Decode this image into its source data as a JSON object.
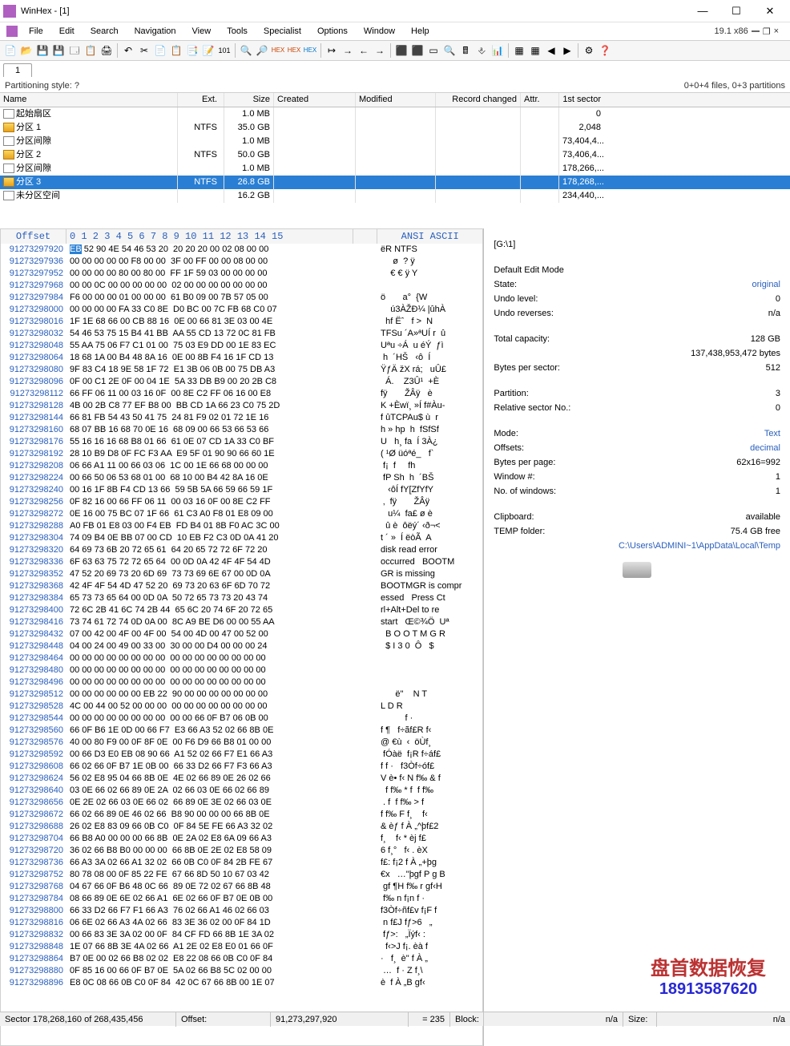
{
  "title": "WinHex - [1]",
  "menus": [
    "File",
    "Edit",
    "Search",
    "Navigation",
    "View",
    "Tools",
    "Specialist",
    "Options",
    "Window",
    "Help"
  ],
  "version": "19.1 x86",
  "tab": "1",
  "summary_left": "Partitioning style: ?",
  "summary_right": "0+0+4 files, 0+3 partitions",
  "cols": {
    "name": "Name",
    "ext": "Ext.",
    "size": "Size",
    "created": "Created",
    "modified": "Modified",
    "rec": "Record changed",
    "attr": "Attr.",
    "sector": "1st sector"
  },
  "rows": [
    {
      "name": "起始扇区",
      "ext": "",
      "size": "1.0 MB",
      "sector": "0",
      "ic": "ic-file"
    },
    {
      "name": "分区 1",
      "ext": "NTFS",
      "size": "35.0 GB",
      "sector": "2,048",
      "ic": "ic-part"
    },
    {
      "name": "分区间隙",
      "ext": "",
      "size": "1.0 MB",
      "sector": "73,404,4...",
      "ic": "ic-gap"
    },
    {
      "name": "分区 2",
      "ext": "NTFS",
      "size": "50.0 GB",
      "sector": "73,406,4...",
      "ic": "ic-part"
    },
    {
      "name": "分区间隙",
      "ext": "",
      "size": "1.0 MB",
      "sector": "178,266,...",
      "ic": "ic-gap"
    },
    {
      "name": "分区 3",
      "ext": "NTFS",
      "size": "26.8 GB",
      "sector": "178,268,...",
      "ic": "ic-part",
      "sel": true
    },
    {
      "name": "未分区空间",
      "ext": "",
      "size": "16.2 GB",
      "sector": "234,440,...",
      "ic": "ic-gap"
    }
  ],
  "hex_headers": {
    "offset": "Offset",
    "bytes": " 0  1  2  3  4  5  6  7   8  9 10 11 12 13 14 15",
    "ascii": "ANSI ASCII"
  },
  "hex": [
    {
      "o": "91273297920",
      "b": "EB 52 90 4E 54 46 53 20  20 20 20 00 02 08 00 00",
      "a": "ëR NTFS         ",
      "hl": true
    },
    {
      "o": "91273297936",
      "b": "00 00 00 00 00 F8 00 00  3F 00 FF 00 00 08 00 00",
      "a": "     ø  ? ÿ     "
    },
    {
      "o": "91273297952",
      "b": "00 00 00 00 80 00 80 00  FF 1F 59 03 00 00 00 00",
      "a": "    € € ÿ Y     "
    },
    {
      "o": "91273297968",
      "b": "00 00 0C 00 00 00 00 00  02 00 00 00 00 00 00 00",
      "a": "                "
    },
    {
      "o": "91273297984",
      "b": "F6 00 00 00 01 00 00 00  61 B0 09 00 7B 57 05 00",
      "a": "ö       a°  {W  "
    },
    {
      "o": "91273298000",
      "b": "00 00 00 00 FA 33 C0 8E  D0 BC 00 7C FB 68 C0 07",
      "a": "    ú3ÀŽÐ¼ |ûhÀ "
    },
    {
      "o": "91273298016",
      "b": "1F 1E 68 66 00 CB 88 16  0E 00 66 81 3E 03 00 4E",
      "a": "  hf Ëˆ   f >  N"
    },
    {
      "o": "91273298032",
      "b": "54 46 53 75 15 B4 41 BB  AA 55 CD 13 72 0C 81 FB",
      "a": "TFSu ´A»ªUÍ r  û"
    },
    {
      "o": "91273298048",
      "b": "55 AA 75 06 F7 C1 01 00  75 03 E9 DD 00 1E 83 EC",
      "a": "Uªu ÷Á  u éÝ  ƒì"
    },
    {
      "o": "91273298064",
      "b": "18 68 1A 00 B4 48 8A 16  0E 00 8B F4 16 1F CD 13",
      "a": " h  ´HŠ   ‹ô  Í "
    },
    {
      "o": "91273298080",
      "b": "9F 83 C4 18 9E 58 1F 72  E1 3B 06 0B 00 75 DB A3",
      "a": "ŸƒÄ žX rá;   uÛ£"
    },
    {
      "o": "91273298096",
      "b": "0F 00 C1 2E 0F 00 04 1E  5A 33 DB B9 00 20 2B C8",
      "a": "  Á.    Z3Û¹  +È"
    },
    {
      "o": "91273298112",
      "b": "66 FF 06 11 00 03 16 0F  00 8E C2 FF 06 16 00 E8",
      "a": "fÿ       ŽÂÿ   è"
    },
    {
      "o": "91273298128",
      "b": "4B 00 2B C8 77 EF B8 00  BB CD 1A 66 23 C0 75 2D",
      "a": "K +Èwï¸ »Í f#Àu-"
    },
    {
      "o": "91273298144",
      "b": "66 81 FB 54 43 50 41 75  24 81 F9 02 01 72 1E 16",
      "a": "f ûTCPAu$ ù  r  "
    },
    {
      "o": "91273298160",
      "b": "68 07 BB 16 68 70 0E 16  68 09 00 66 53 66 53 66",
      "a": "h » hp  h  fSfSf"
    },
    {
      "o": "91273298176",
      "b": "55 16 16 16 68 B8 01 66  61 0E 07 CD 1A 33 C0 BF",
      "a": "U   h¸ fa  Í 3À¿"
    },
    {
      "o": "91273298192",
      "b": "28 10 B9 D8 0F FC F3 AA  E9 5F 01 90 90 66 60 1E",
      "a": "( ¹Ø üóªé_   f` "
    },
    {
      "o": "91273298208",
      "b": "06 66 A1 11 00 66 03 06  1C 00 1E 66 68 00 00 00",
      "a": " f¡  f     fh   "
    },
    {
      "o": "91273298224",
      "b": "00 66 50 06 53 68 01 00  68 10 00 B4 42 8A 16 0E",
      "a": " fP Sh  h  ´BŠ  "
    },
    {
      "o": "91273298240",
      "b": "00 16 1F 8B F4 CD 13 66  59 5B 5A 66 59 66 59 1F",
      "a": "   ‹ôÍ fY[ZfYfY "
    },
    {
      "o": "91273298256",
      "b": "0F 82 16 00 66 FF 06 11  00 03 16 0F 00 8E C2 FF",
      "a": " ‚  fÿ       ŽÂÿ"
    },
    {
      "o": "91273298272",
      "b": "0E 16 00 75 BC 07 1F 66  61 C3 A0 F8 01 E8 09 00",
      "a": "   u¼  fa£ ø è  "
    },
    {
      "o": "91273298288",
      "b": "A0 FB 01 E8 03 00 F4 EB  FD B4 01 8B F0 AC 3C 00",
      "a": "  û è  ôëý´ ‹ð¬<"
    },
    {
      "o": "91273298304",
      "b": "74 09 B4 0E BB 07 00 CD  10 EB F2 C3 0D 0A 41 20",
      "a": "t ´ »  Í ëòÃ  A "
    },
    {
      "o": "91273298320",
      "b": "64 69 73 6B 20 72 65 61  64 20 65 72 72 6F 72 20",
      "a": "disk read error "
    },
    {
      "o": "91273298336",
      "b": "6F 63 63 75 72 72 65 64  00 0D 0A 42 4F 4F 54 4D",
      "a": "occurred   BOOTM"
    },
    {
      "o": "91273298352",
      "b": "47 52 20 69 73 20 6D 69  73 73 69 6E 67 00 0D 0A",
      "a": "GR is missing   "
    },
    {
      "o": "91273298368",
      "b": "42 4F 4F 54 4D 47 52 20  69 73 20 63 6F 6D 70 72",
      "a": "BOOTMGR is compr"
    },
    {
      "o": "91273298384",
      "b": "65 73 73 65 64 00 0D 0A  50 72 65 73 73 20 43 74",
      "a": "essed   Press Ct"
    },
    {
      "o": "91273298400",
      "b": "72 6C 2B 41 6C 74 2B 44  65 6C 20 74 6F 20 72 65",
      "a": "rl+Alt+Del to re"
    },
    {
      "o": "91273298416",
      "b": "73 74 61 72 74 0D 0A 00  8C A9 BE D6 00 00 55 AA",
      "a": "start   Œ©¾Ö  Uª"
    },
    {
      "o": "91273298432",
      "b": "07 00 42 00 4F 00 4F 00  54 00 4D 00 47 00 52 00",
      "a": "  B O O T M G R "
    },
    {
      "o": "91273298448",
      "b": "04 00 24 00 49 00 33 00  30 00 00 D4 00 00 00 24",
      "a": "  $ I 3 0  Ô   $"
    },
    {
      "o": "91273298464",
      "b": "00 00 00 00 00 00 00 00  00 00 00 00 00 00 00 00",
      "a": "                "
    },
    {
      "o": "91273298480",
      "b": "00 00 00 00 00 00 00 00  00 00 00 00 00 00 00 00",
      "a": "                "
    },
    {
      "o": "91273298496",
      "b": "00 00 00 00 00 00 00 00  00 00 00 00 00 00 00 00",
      "a": "                "
    },
    {
      "o": "91273298512",
      "b": "00 00 00 00 00 00 EB 22  90 00 00 00 00 00 00 00",
      "a": "      ë\"    N T "
    },
    {
      "o": "91273298528",
      "b": "4C 00 44 00 52 00 00 00  00 00 00 00 00 00 00 00",
      "a": "L D R           "
    },
    {
      "o": "91273298544",
      "b": "00 00 00 00 00 00 00 00  00 00 66 0F B7 06 0B 00",
      "a": "          f ·   "
    },
    {
      "o": "91273298560",
      "b": "66 0F B6 1E 0D 00 66 F7  E3 66 A3 52 02 66 8B 0E",
      "a": "f ¶   f÷ãf£R f‹ "
    },
    {
      "o": "91273298576",
      "b": "40 00 80 F9 00 0F 8F 0E  00 F6 D9 66 B8 01 00 00",
      "a": "@ €ù  ‹  öÙf¸   "
    },
    {
      "o": "91273298592",
      "b": "00 66 D3 E0 EB 08 90 66  A1 52 02 66 F7 E1 66 A3",
      "a": " fÓàë  f¡R f÷áf£"
    },
    {
      "o": "91273298608",
      "b": "66 02 66 0F B7 1E 0B 00  66 33 D2 66 F7 F3 66 A3",
      "a": "f f ·   f3Òf÷óf£"
    },
    {
      "o": "91273298624",
      "b": "56 02 E8 95 04 66 8B 0E  4E 02 66 89 0E 26 02 66",
      "a": "V è• f‹ N f‰ & f"
    },
    {
      "o": "91273298640",
      "b": "03 0E 66 02 66 89 0E 2A  02 66 03 0E 66 02 66 89",
      "a": "  f f‰ * f  f f‰"
    },
    {
      "o": "91273298656",
      "b": "0E 2E 02 66 03 0E 66 02  66 89 0E 3E 02 66 03 0E",
      "a": " . f  f f‰ > f  "
    },
    {
      "o": "91273298672",
      "b": "66 02 66 89 0E 46 02 66  B8 90 00 00 00 66 8B 0E",
      "a": "f f‰ F f¸    f‹ "
    },
    {
      "o": "91273298688",
      "b": "26 02 E8 83 09 66 0B C0  0F 84 5E FE 66 A3 32 02",
      "a": "& èƒ f À „^þf£2 "
    },
    {
      "o": "91273298704",
      "b": "66 B8 A0 00 00 00 66 8B  0E 2A 02 E8 6A 09 66 A3",
      "a": "f¸    f‹ * èj f£"
    },
    {
      "o": "91273298720",
      "b": "36 02 66 B8 B0 00 00 00  66 8B 0E 2E 02 E8 58 09",
      "a": "6 f¸°   f‹ . èX "
    },
    {
      "o": "91273298736",
      "b": "66 A3 3A 02 66 A1 32 02  66 0B C0 0F 84 2B FE 67",
      "a": "f£: f¡2 f À „+þg"
    },
    {
      "o": "91273298752",
      "b": "80 78 08 00 0F 85 22 FE  67 66 8D 50 10 67 03 42",
      "a": "€x   …\"þgf P g B"
    },
    {
      "o": "91273298768",
      "b": "04 67 66 0F B6 48 0C 66  89 0E 72 02 67 66 8B 48",
      "a": " gf ¶H f‰ r gf‹H"
    },
    {
      "o": "91273298784",
      "b": "08 66 89 0E 6E 02 66 A1  6E 02 66 0F B7 0E 0B 00",
      "a": " f‰ n f¡n f ·   "
    },
    {
      "o": "91273298800",
      "b": "66 33 D2 66 F7 F1 66 A3  76 02 66 A1 46 02 66 03",
      "a": "f3Òf÷ñf£v f¡F f "
    },
    {
      "o": "91273298816",
      "b": "06 6E 02 66 A3 4A 02 66  83 3E 36 02 00 0F 84 1D",
      "a": " n f£J fƒ>6   „ "
    },
    {
      "o": "91273298832",
      "b": "00 66 83 3E 3A 02 00 0F  84 CF FD 66 8B 1E 3A 02",
      "a": " fƒ>:   „Ïýf‹ : "
    },
    {
      "o": "91273298848",
      "b": "1E 07 66 8B 3E 4A 02 66  A1 2E 02 E8 E0 01 66 0F",
      "a": "  f‹>J f¡. èà f "
    },
    {
      "o": "91273298864",
      "b": "B7 0E 00 02 66 B8 02 02  E8 22 08 66 0B C0 0F 84",
      "a": "·   f¸  è\" f À „"
    },
    {
      "o": "91273298880",
      "b": "0F 85 16 00 66 0F B7 0E  5A 02 66 B8 5C 02 00 00",
      "a": " …  f · Z f¸\\   "
    },
    {
      "o": "91273298896",
      "b": "E8 0C 08 66 0B C0 0F 84  42 0C 67 66 8B 00 1E 07",
      "a": "è  f À „B gf‹   "
    }
  ],
  "info": {
    "path": "[G:\\1]",
    "mode_title": "Default Edit Mode",
    "state_l": "State:",
    "state_v": "original",
    "undo_l": "Undo level:",
    "undo_v": "0",
    "undor_l": "Undo reverses:",
    "undor_v": "n/a",
    "cap_l": "Total capacity:",
    "cap_v": "128 GB",
    "cap_b": "137,438,953,472 bytes",
    "bps_l": "Bytes per sector:",
    "bps_v": "512",
    "part_l": "Partition:",
    "part_v": "3",
    "rel_l": "Relative sector No.:",
    "rel_v": "0",
    "dmode_l": "Mode:",
    "dmode_v": "Text",
    "off_l": "Offsets:",
    "off_v": "decimal",
    "bpp_l": "Bytes per page:",
    "bpp_v": "62x16=992",
    "win_l": "Window #:",
    "win_v": "1",
    "nwin_l": "No. of windows:",
    "nwin_v": "1",
    "clip_l": "Clipboard:",
    "clip_v": "available",
    "temp_l": "TEMP folder:",
    "temp_v": "75.4 GB free",
    "temp_path": "C:\\Users\\ADMINI~1\\AppData\\Local\\Temp"
  },
  "watermark": {
    "cn": "盘首数据恢复",
    "ph": "18913587620"
  },
  "status": {
    "sector": "Sector 178,268,160 of 268,435,456",
    "offset_l": "Offset:",
    "offset_v": "91,273,297,920",
    "eq": "= 235",
    "block_l": "Block:",
    "block_v": "n/a",
    "size_l": "Size:",
    "size_v": "n/a"
  }
}
